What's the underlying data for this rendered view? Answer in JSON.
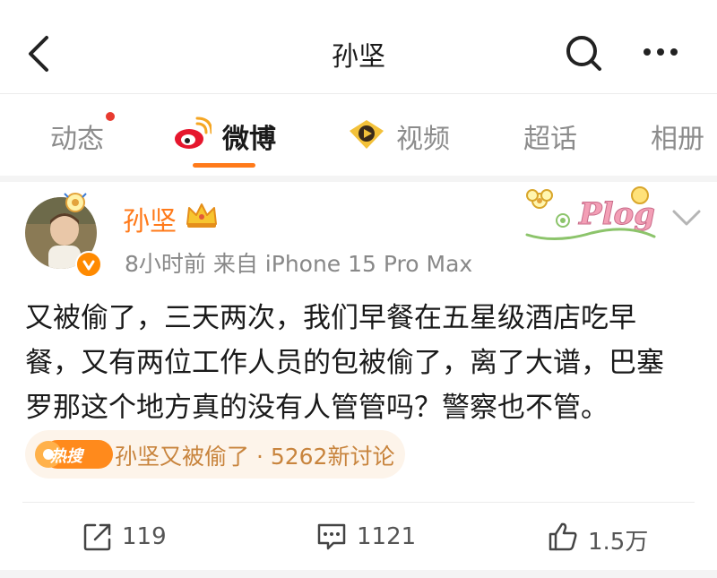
{
  "nav": {
    "title": "孙坚"
  },
  "tabs": [
    {
      "label": "动态"
    },
    {
      "label": "微博"
    },
    {
      "label": "视频"
    },
    {
      "label": "超话"
    },
    {
      "label": "相册"
    }
  ],
  "post": {
    "username": "孙坚",
    "meta": "8小时前  来自 iPhone 15 Pro Max",
    "sticker_text": "Plog",
    "lines": [
      "又被偷了，三天两次，我们早餐在五星级酒店吃早",
      "餐，又有两位工作人员的包被偷了，离了大谱，巴塞",
      "罗那这个地方真的没有人管管吗？警察也不管。"
    ],
    "hot": {
      "badge": "热搜",
      "text": "孙坚又被偷了 · 5262新讨论"
    }
  },
  "actions": {
    "repost": "119",
    "comment": "1121",
    "like": "1.5万"
  },
  "colors": {
    "accent": "#ff7a1a",
    "hot_text": "#c8843d",
    "hot_bg": "#fdf4ea",
    "notification_dot": "#e83a2f"
  },
  "icons": [
    "back-arrow-icon",
    "search-icon",
    "more-icon",
    "weibo-logo-icon",
    "video-badge-icon",
    "crown-icon",
    "verified-badge-icon",
    "chevron-down-icon",
    "repost-icon",
    "comment-icon",
    "like-icon"
  ]
}
